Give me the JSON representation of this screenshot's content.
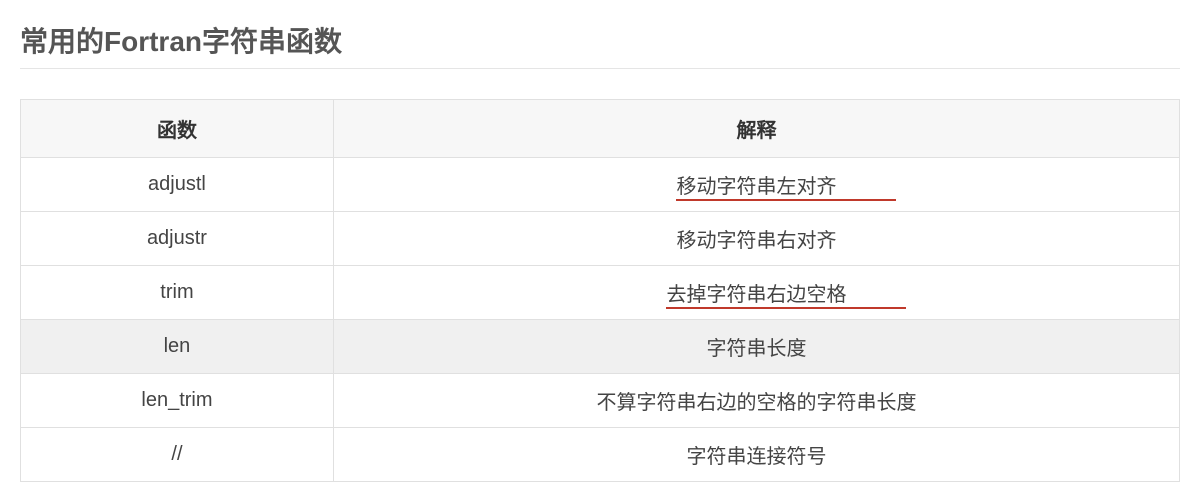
{
  "title": "常用的Fortran字符串函数",
  "headers": {
    "func": "函数",
    "desc": "解释"
  },
  "rows": [
    {
      "func": "adjustl",
      "desc": "移动字符串左对齐"
    },
    {
      "func": "adjustr",
      "desc": "移动字符串右对齐"
    },
    {
      "func": "trim",
      "desc": "去掉字符串右边空格"
    },
    {
      "func": "len",
      "desc": "字符串长度"
    },
    {
      "func": "len_trim",
      "desc": "不算字符串右边的空格的字符串长度"
    },
    {
      "func": "//",
      "desc": "字符串连接符号"
    }
  ]
}
